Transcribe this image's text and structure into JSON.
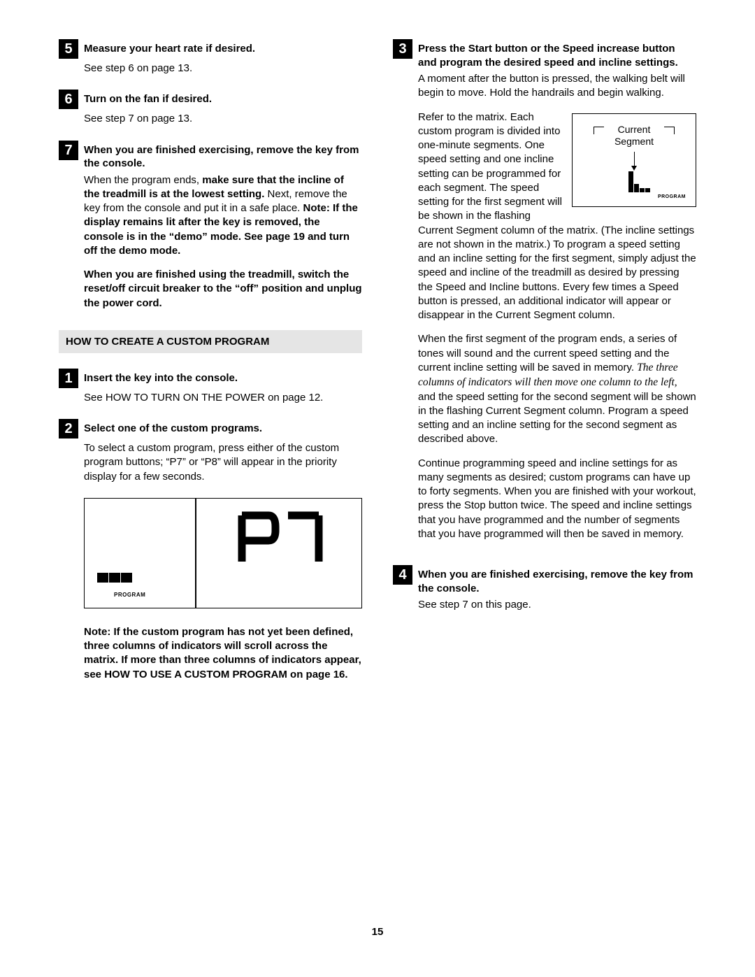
{
  "section_heading": "HOW TO CREATE A CUSTOM PROGRAM",
  "page_number": "15",
  "display_program_label": "PROGRAM",
  "small_display": {
    "line1": "Current",
    "line2": "Segment",
    "program_label": "PROGRAM"
  },
  "left": {
    "s5": {
      "num": "5",
      "title": "Measure your heart rate if desired.",
      "body": "See step 6 on page 13."
    },
    "s6": {
      "num": "6",
      "title": "Turn on the fan if desired.",
      "body": "See step 7 on page 13."
    },
    "s7": {
      "num": "7",
      "title": "When you are finished exercising, remove the key from the console.",
      "p1a": "When the program ends, ",
      "p1b": "make sure that the incline of the treadmill is at the lowest setting.",
      "p1c": " Next, remove the key from the console and put it in a safe place. ",
      "p1d": "Note: If the display remains lit after the key is removed, the console is in the “demo” mode. See page 19 and turn off the demo mode.",
      "p2": "When you are finished using the treadmill, switch the reset/off circuit breaker to the “off” position and unplug the power cord."
    },
    "c1": {
      "num": "1",
      "title": "Insert the key into the console.",
      "body": "See HOW TO TURN ON THE POWER on page 12."
    },
    "c2": {
      "num": "2",
      "title": "Select one of the custom programs.",
      "body": "To select a custom program, press either of the custom program buttons; “P7” or “P8” will appear in the priority display for a few seconds.",
      "note": "Note: If the custom program has not yet been defined, three columns of indicators will scroll across the matrix. If more than three columns of indicators appear, see HOW TO USE A CUSTOM PROGRAM on page 16."
    }
  },
  "right": {
    "c3": {
      "num": "3",
      "title": "Press the Start button or the Speed increase button and program the desired speed and incline settings.",
      "p1": "A moment after the button is pressed, the walking belt will begin to move. Hold the handrails and begin walking.",
      "p2a": "Refer to the matrix. Each custom program is divided into one-minute segments. One speed setting and one incline setting can be programmed for each segment. The speed setting for the first segment will be shown in the flashing Current Segment column of the matrix. (The incline settings are not shown in the matrix.) To program a speed setting and an incline set",
      "p2b": "ting for the first segment, simply adjust the speed and incline of the treadmill as desired by pressing the Speed and Incline buttons. Every few times a Speed button is pressed, an additional indicator will appear or disappear in the Current Segment column.",
      "p3a": "When the first segment of the program ends, a series of tones will sound and the current speed setting and the current incline setting will be saved in memory. ",
      "p3b": "The three columns of indicators will then move one column to the left,",
      "p3c": " and the speed setting for the second segment will be shown in the flashing Current Segment column. Program a speed setting and an incline setting for the second segment as described above.",
      "p4": "Continue programming speed and incline settings for as many segments as desired; custom programs can have up to forty segments. When you are finished with your workout, press the Stop button twice. The speed and incline settings that you have programmed and the number of segments that you have programmed will then be saved in memory."
    },
    "c4": {
      "num": "4",
      "title": "When you are finished exercising, remove the key from the console.",
      "body": "See step 7 on this page."
    }
  }
}
